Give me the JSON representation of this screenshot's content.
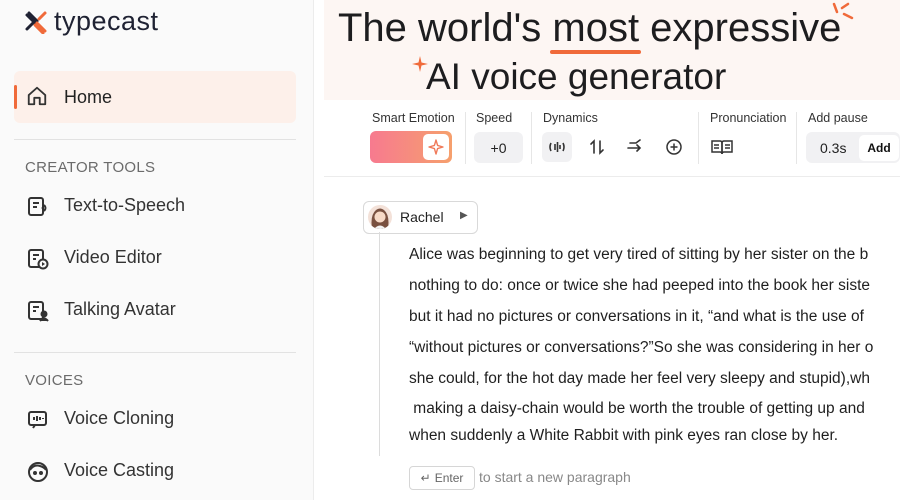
{
  "brand": {
    "name": "typecast",
    "accent": "#f06a3a"
  },
  "sidebar": {
    "home": {
      "label": "Home",
      "icon": "home-icon"
    },
    "sections": [
      {
        "title": "CREATOR TOOLS",
        "items": [
          {
            "label": "Text-to-Speech",
            "icon": "tts-icon"
          },
          {
            "label": "Video Editor",
            "icon": "video-editor-icon"
          },
          {
            "label": "Talking Avatar",
            "icon": "talking-avatar-icon"
          }
        ]
      },
      {
        "title": "VOICES",
        "items": [
          {
            "label": "Voice Cloning",
            "icon": "voice-cloning-icon"
          },
          {
            "label": "Voice Casting",
            "icon": "voice-casting-icon"
          }
        ]
      }
    ]
  },
  "hero": {
    "line1_pre": "The world's ",
    "line1_emph": "most",
    "line1_post": " expressive",
    "line2": "AI voice generator"
  },
  "toolbar": {
    "smart_emotion_label": "Smart Emotion",
    "speed_label": "Speed",
    "speed_value": "+0",
    "dynamics_label": "Dynamics",
    "pronunciation_label": "Pronunciation",
    "add_pause_label": "Add pause",
    "pause_value": "0.3s",
    "add_button": "Add"
  },
  "editor": {
    "speaker_name": "Rachel",
    "lines": [
      "Alice was beginning to get very tired of sitting by her sister on the b",
      "nothing to do: once or twice she had peeped into the book her siste",
      "but it had no pictures or conversations in it, “and what is the use of",
      "“without pictures or conversations?”So she was considering in her o",
      "she could, for the hot day made her feel very sleepy and stupid),wh",
      " making a daisy-chain would be worth the trouble of getting up and",
      "when suddenly a White Rabbit with pink eyes ran close by her."
    ],
    "enter_key": "Enter",
    "enter_hint": "to start a new paragraph"
  }
}
